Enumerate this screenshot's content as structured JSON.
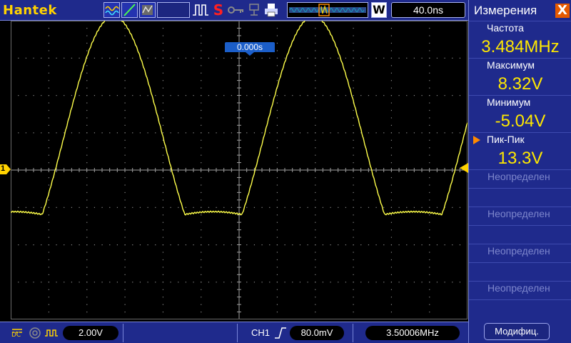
{
  "brand": "Hantek",
  "toolbar": {
    "run_state_label": "S",
    "horizontal_mode_label": "W",
    "time_per_div": "40.0ns"
  },
  "trigger": {
    "position": "0.000s",
    "channel_marker": "1"
  },
  "bottom": {
    "ch1_volts_per_div": "2.00V",
    "trigger_source": "CH1",
    "trigger_level": "80.0mV",
    "trigger_frequency": "3.50006MHz"
  },
  "panel": {
    "title": "Измерения",
    "close_label": "X",
    "measurements": [
      {
        "label": "Частота",
        "value": "3.484MHz",
        "selected": false
      },
      {
        "label": "Максимум",
        "value": "8.32V",
        "selected": false
      },
      {
        "label": "Минимум",
        "value": "-5.04V",
        "selected": false
      },
      {
        "label": "Пик-Пик",
        "value": "13.3V",
        "selected": true
      }
    ],
    "undefined_slots": [
      "Неопределен",
      "Неопределен",
      "Неопределен",
      "Неопределен"
    ],
    "modify_button": "Модифиц."
  },
  "colors": {
    "trace": "#ffff4a",
    "bar": "#1f2a8c",
    "value": "#ffe800",
    "trigger_marker": "#ffd200",
    "accent": "#e65a00"
  },
  "icons": [
    "wave-icon",
    "line-icon",
    "persist-icon",
    "pulse-icon",
    "key-icon",
    "usb-icon",
    "printer-icon",
    "memory-depth-icon",
    "dc-coupling-icon",
    "bandwidth-icon",
    "invert-icon",
    "rising-edge-icon",
    "close-icon",
    "selected-arrow-icon"
  ]
}
